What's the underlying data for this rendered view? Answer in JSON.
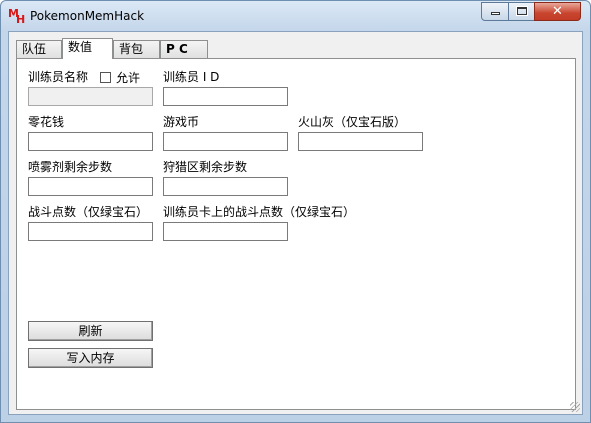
{
  "window": {
    "title": "PokemonMemHack",
    "icon_m": "M",
    "icon_h": "H",
    "controls": {
      "close_glyph": "✕"
    }
  },
  "tabs": [
    {
      "label": "队伍",
      "active": false
    },
    {
      "label": "数值",
      "active": true
    },
    {
      "label": "背包",
      "active": false
    },
    {
      "label": "P C",
      "active": false
    }
  ],
  "fields": {
    "trainer_name": {
      "label": "训练员名称",
      "value": "",
      "disabled": true
    },
    "allow_checkbox": {
      "label": "允许",
      "checked": false
    },
    "trainer_id": {
      "label": "训练员 I D",
      "value": ""
    },
    "money": {
      "label": "零花钱",
      "value": ""
    },
    "coins": {
      "label": "游戏币",
      "value": ""
    },
    "volcanic_ash": {
      "label": "火山灰（仅宝石版）",
      "value": ""
    },
    "repel_steps": {
      "label": "喷雾剂剩余步数",
      "value": ""
    },
    "safari_steps": {
      "label": "狩猎区剩余步数",
      "value": ""
    },
    "battle_points": {
      "label": "战斗点数（仅绿宝石）",
      "value": ""
    },
    "card_battle_points": {
      "label": "训练员卡上的战斗点数（仅绿宝石）",
      "value": ""
    }
  },
  "buttons": {
    "refresh": "刷新",
    "write_memory": "写入内存"
  }
}
